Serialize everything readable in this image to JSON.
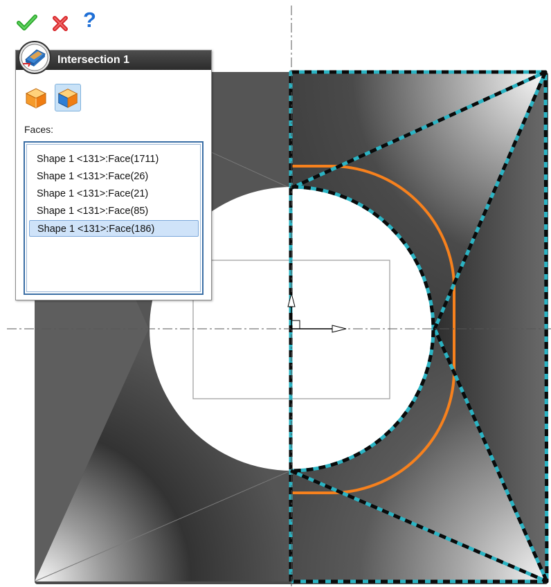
{
  "toolbar": {
    "ok_icon": "check-icon",
    "cancel_icon": "close-icon",
    "help_icon": "help-icon",
    "help_glyph": "?"
  },
  "panel": {
    "title": "Intersection 1",
    "badge_icon": "intersection-feature-icon",
    "modes": [
      {
        "name": "solid-mode-icon"
      },
      {
        "name": "surface-mode-icon",
        "active": true
      }
    ],
    "faces_label": "Faces:",
    "faces": [
      "Shape 1 <131>:Face(1711)",
      "Shape 1 <131>:Face(26)",
      "Shape 1 <131>:Face(21)",
      "Shape 1 <131>:Face(85)",
      "Shape 1 <131>:Face(186)"
    ],
    "selected_face": 4
  },
  "colors": {
    "accent_orange": "#f7811d",
    "selection_cyan": "#2ab3c3",
    "model_dark": "#4a4a4a",
    "panel_header": "#3a3a3a",
    "list_selection": "#cfe3f9"
  }
}
